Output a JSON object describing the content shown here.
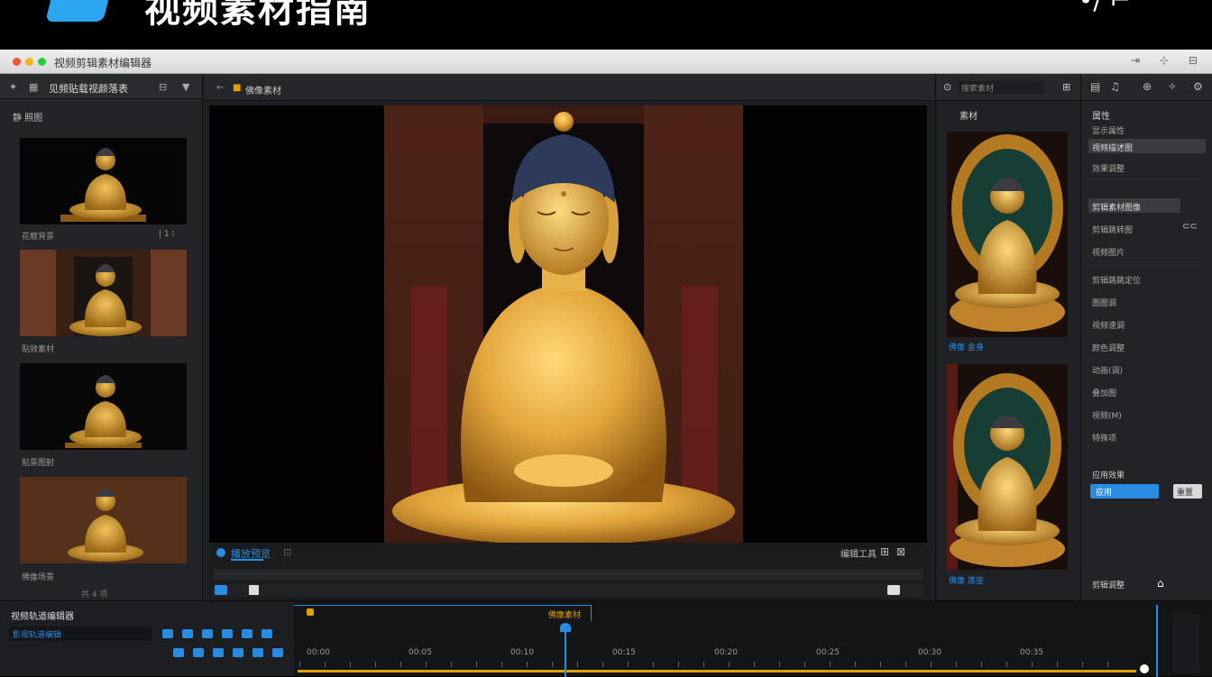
{
  "banner": {
    "title": "视频素材指南",
    "right": "•/ ⌐"
  },
  "window": {
    "title": "视频剪辑素材编辑器",
    "controls": [
      "⇥",
      "⊹",
      "⊟"
    ]
  },
  "media_panel": {
    "header_label": "见频贴载视颜落表",
    "sub_label": "静 照图",
    "items": [
      {
        "caption": "花框背景",
        "extra": "| 1 ⁞"
      },
      {
        "caption": "贴效素材",
        "extra": ""
      },
      {
        "caption": "贴景图射",
        "extra": ""
      },
      {
        "caption": "佛像场景",
        "extra": ""
      }
    ],
    "footer": "共 4 项"
  },
  "preview": {
    "tab_label": "佛像素材",
    "status_label": "播放预览",
    "controls_label": "编辑工具"
  },
  "right_media": {
    "search_placeholder": "搜索素材",
    "header": "素材",
    "items": [
      {
        "caption": "佛像 金身",
        "badge": ""
      },
      {
        "caption": "佛像 莲座",
        "badge": ""
      }
    ]
  },
  "inspector": {
    "title": "属性",
    "fields": [
      "显示属性",
      "视频描述图",
      "效果调整",
      "剪辑素材图像",
      "剪辑跳转图",
      "视频图片",
      "剪辑跳跳定位",
      "图图调",
      "视频速调",
      "颜色调整",
      "动画(调)",
      "叠加图",
      "视频(M)",
      "特殊项"
    ],
    "section": "应用效果",
    "apply_button": "应用",
    "reset_button": "重置",
    "footer": "剪辑调整"
  },
  "timeline": {
    "track_header": "视频轨道编辑器",
    "track_input": "影视轨道编辑",
    "clip_label": "佛像素材",
    "time_labels": [
      "00:00",
      "00:05",
      "00:10",
      "00:15",
      "00:20",
      "00:25",
      "00:30",
      "00:35"
    ],
    "playhead_pct": 0.295
  },
  "colors": {
    "accent": "#2a8ce0",
    "timeline_track": "#e0a200",
    "gold": "#d8a43a"
  }
}
